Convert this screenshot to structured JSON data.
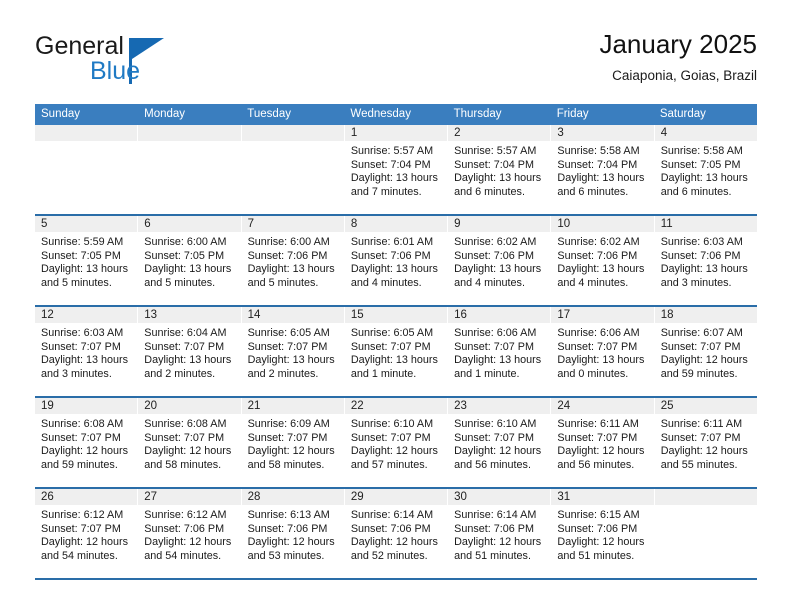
{
  "brand": {
    "word1": "General",
    "word2": "Blue",
    "logo_icon": "triangle-flag-icon",
    "color_primary": "#1669b2",
    "color_blue_text": "#1f7ac4"
  },
  "header": {
    "title": "January 2025",
    "subtitle": "Caiaponia, Goias, Brazil"
  },
  "calendar": {
    "header_bg": "#3a7ebf",
    "rule_color": "#2a6da8",
    "cell_head_bg": "#efefef",
    "weekdays": [
      "Sunday",
      "Monday",
      "Tuesday",
      "Wednesday",
      "Thursday",
      "Friday",
      "Saturday"
    ],
    "weeks": [
      [
        {
          "day": "",
          "l1": "",
          "l2": "",
          "l3": "",
          "l4": "",
          "empty": true
        },
        {
          "day": "",
          "l1": "",
          "l2": "",
          "l3": "",
          "l4": "",
          "empty": true
        },
        {
          "day": "",
          "l1": "",
          "l2": "",
          "l3": "",
          "l4": "",
          "empty": true
        },
        {
          "day": "1",
          "l1": "Sunrise: 5:57 AM",
          "l2": "Sunset: 7:04 PM",
          "l3": "Daylight: 13 hours",
          "l4": "and 7 minutes."
        },
        {
          "day": "2",
          "l1": "Sunrise: 5:57 AM",
          "l2": "Sunset: 7:04 PM",
          "l3": "Daylight: 13 hours",
          "l4": "and 6 minutes."
        },
        {
          "day": "3",
          "l1": "Sunrise: 5:58 AM",
          "l2": "Sunset: 7:04 PM",
          "l3": "Daylight: 13 hours",
          "l4": "and 6 minutes."
        },
        {
          "day": "4",
          "l1": "Sunrise: 5:58 AM",
          "l2": "Sunset: 7:05 PM",
          "l3": "Daylight: 13 hours",
          "l4": "and 6 minutes."
        }
      ],
      [
        {
          "day": "5",
          "l1": "Sunrise: 5:59 AM",
          "l2": "Sunset: 7:05 PM",
          "l3": "Daylight: 13 hours",
          "l4": "and 5 minutes."
        },
        {
          "day": "6",
          "l1": "Sunrise: 6:00 AM",
          "l2": "Sunset: 7:05 PM",
          "l3": "Daylight: 13 hours",
          "l4": "and 5 minutes."
        },
        {
          "day": "7",
          "l1": "Sunrise: 6:00 AM",
          "l2": "Sunset: 7:06 PM",
          "l3": "Daylight: 13 hours",
          "l4": "and 5 minutes."
        },
        {
          "day": "8",
          "l1": "Sunrise: 6:01 AM",
          "l2": "Sunset: 7:06 PM",
          "l3": "Daylight: 13 hours",
          "l4": "and 4 minutes."
        },
        {
          "day": "9",
          "l1": "Sunrise: 6:02 AM",
          "l2": "Sunset: 7:06 PM",
          "l3": "Daylight: 13 hours",
          "l4": "and 4 minutes."
        },
        {
          "day": "10",
          "l1": "Sunrise: 6:02 AM",
          "l2": "Sunset: 7:06 PM",
          "l3": "Daylight: 13 hours",
          "l4": "and 4 minutes."
        },
        {
          "day": "11",
          "l1": "Sunrise: 6:03 AM",
          "l2": "Sunset: 7:06 PM",
          "l3": "Daylight: 13 hours",
          "l4": "and 3 minutes."
        }
      ],
      [
        {
          "day": "12",
          "l1": "Sunrise: 6:03 AM",
          "l2": "Sunset: 7:07 PM",
          "l3": "Daylight: 13 hours",
          "l4": "and 3 minutes."
        },
        {
          "day": "13",
          "l1": "Sunrise: 6:04 AM",
          "l2": "Sunset: 7:07 PM",
          "l3": "Daylight: 13 hours",
          "l4": "and 2 minutes."
        },
        {
          "day": "14",
          "l1": "Sunrise: 6:05 AM",
          "l2": "Sunset: 7:07 PM",
          "l3": "Daylight: 13 hours",
          "l4": "and 2 minutes."
        },
        {
          "day": "15",
          "l1": "Sunrise: 6:05 AM",
          "l2": "Sunset: 7:07 PM",
          "l3": "Daylight: 13 hours",
          "l4": "and 1 minute."
        },
        {
          "day": "16",
          "l1": "Sunrise: 6:06 AM",
          "l2": "Sunset: 7:07 PM",
          "l3": "Daylight: 13 hours",
          "l4": "and 1 minute."
        },
        {
          "day": "17",
          "l1": "Sunrise: 6:06 AM",
          "l2": "Sunset: 7:07 PM",
          "l3": "Daylight: 13 hours",
          "l4": "and 0 minutes."
        },
        {
          "day": "18",
          "l1": "Sunrise: 6:07 AM",
          "l2": "Sunset: 7:07 PM",
          "l3": "Daylight: 12 hours",
          "l4": "and 59 minutes."
        }
      ],
      [
        {
          "day": "19",
          "l1": "Sunrise: 6:08 AM",
          "l2": "Sunset: 7:07 PM",
          "l3": "Daylight: 12 hours",
          "l4": "and 59 minutes."
        },
        {
          "day": "20",
          "l1": "Sunrise: 6:08 AM",
          "l2": "Sunset: 7:07 PM",
          "l3": "Daylight: 12 hours",
          "l4": "and 58 minutes."
        },
        {
          "day": "21",
          "l1": "Sunrise: 6:09 AM",
          "l2": "Sunset: 7:07 PM",
          "l3": "Daylight: 12 hours",
          "l4": "and 58 minutes."
        },
        {
          "day": "22",
          "l1": "Sunrise: 6:10 AM",
          "l2": "Sunset: 7:07 PM",
          "l3": "Daylight: 12 hours",
          "l4": "and 57 minutes."
        },
        {
          "day": "23",
          "l1": "Sunrise: 6:10 AM",
          "l2": "Sunset: 7:07 PM",
          "l3": "Daylight: 12 hours",
          "l4": "and 56 minutes."
        },
        {
          "day": "24",
          "l1": "Sunrise: 6:11 AM",
          "l2": "Sunset: 7:07 PM",
          "l3": "Daylight: 12 hours",
          "l4": "and 56 minutes."
        },
        {
          "day": "25",
          "l1": "Sunrise: 6:11 AM",
          "l2": "Sunset: 7:07 PM",
          "l3": "Daylight: 12 hours",
          "l4": "and 55 minutes."
        }
      ],
      [
        {
          "day": "26",
          "l1": "Sunrise: 6:12 AM",
          "l2": "Sunset: 7:07 PM",
          "l3": "Daylight: 12 hours",
          "l4": "and 54 minutes."
        },
        {
          "day": "27",
          "l1": "Sunrise: 6:12 AM",
          "l2": "Sunset: 7:06 PM",
          "l3": "Daylight: 12 hours",
          "l4": "and 54 minutes."
        },
        {
          "day": "28",
          "l1": "Sunrise: 6:13 AM",
          "l2": "Sunset: 7:06 PM",
          "l3": "Daylight: 12 hours",
          "l4": "and 53 minutes."
        },
        {
          "day": "29",
          "l1": "Sunrise: 6:14 AM",
          "l2": "Sunset: 7:06 PM",
          "l3": "Daylight: 12 hours",
          "l4": "and 52 minutes."
        },
        {
          "day": "30",
          "l1": "Sunrise: 6:14 AM",
          "l2": "Sunset: 7:06 PM",
          "l3": "Daylight: 12 hours",
          "l4": "and 51 minutes."
        },
        {
          "day": "31",
          "l1": "Sunrise: 6:15 AM",
          "l2": "Sunset: 7:06 PM",
          "l3": "Daylight: 12 hours",
          "l4": "and 51 minutes."
        },
        {
          "day": "",
          "l1": "",
          "l2": "",
          "l3": "",
          "l4": "",
          "empty": true
        }
      ]
    ]
  }
}
